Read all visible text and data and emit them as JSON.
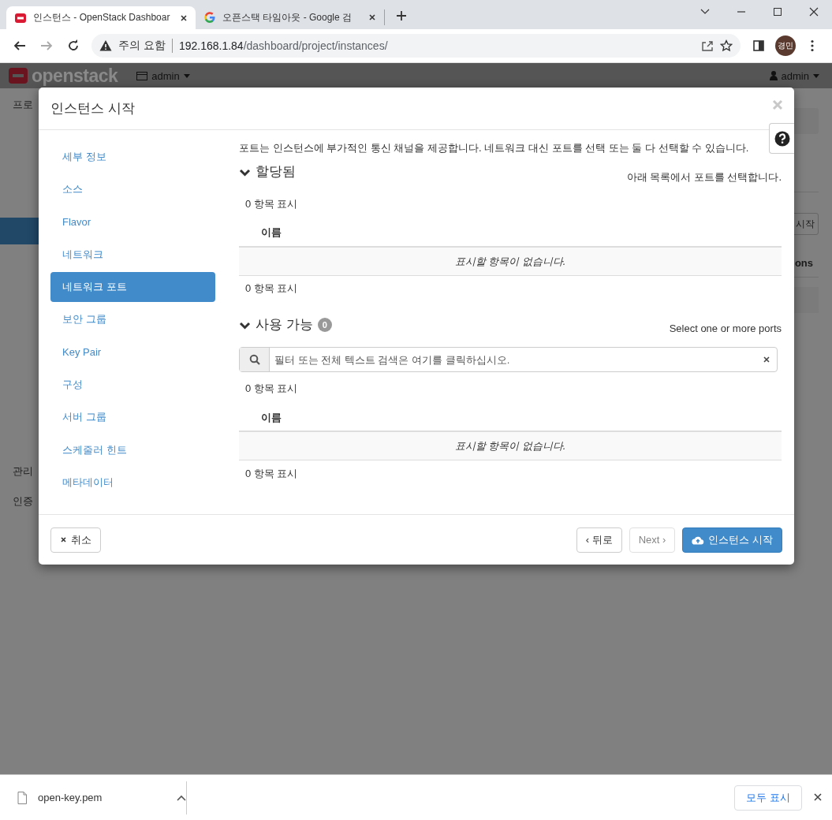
{
  "browser": {
    "tabs": [
      {
        "title": "인스턴스 - OpenStack Dashboar",
        "kind": "openstack",
        "selected": true
      },
      {
        "title": "오픈스택 타임아웃 - Google 검",
        "kind": "google",
        "selected": false
      }
    ],
    "security_label": "주의 요함",
    "url": {
      "host": "192.168.1.84",
      "path": "/dashboard/project/instances/"
    },
    "profile": "경민"
  },
  "navbar": {
    "logo": "openstack",
    "project": "admin",
    "user": "admin"
  },
  "background": {
    "sidebar": [
      {
        "label": "프로",
        "kind": "text"
      },
      {
        "kind": "highlight"
      },
      {
        "label": "관리",
        "kind": "text"
      },
      {
        "label": "인증",
        "kind": "text"
      }
    ],
    "button": "시작",
    "column_header": "ons"
  },
  "modal": {
    "title": "인스턴스 시작",
    "steps": [
      {
        "label": "세부 정보",
        "selected": false
      },
      {
        "label": "소스",
        "selected": false
      },
      {
        "label": "Flavor",
        "selected": false
      },
      {
        "label": "네트워크",
        "selected": false
      },
      {
        "label": "네트워크 포트",
        "selected": true
      },
      {
        "label": "보안 그룹",
        "selected": false
      },
      {
        "label": "Key Pair",
        "selected": false
      },
      {
        "label": "구성",
        "selected": false
      },
      {
        "label": "서버 그룹",
        "selected": false
      },
      {
        "label": "스케줄러 힌트",
        "selected": false
      },
      {
        "label": "메타데이터",
        "selected": false
      }
    ],
    "description": "포트는 인스턴스에 부가적인 통신 채널을 제공합니다. 네트워크 대신 포트를 선택 또는 둘 다 선택할 수 있습니다.",
    "sections": [
      {
        "title": "할당됨",
        "help": "아래 목록에서 포트를 선택합니다.",
        "count_top": "0 항목 표시",
        "column": "이름",
        "empty": "표시할 항목이 없습니다.",
        "count_bottom": "0 항목 표시",
        "expanded": true
      },
      {
        "title": "사용 가능",
        "badge": "0",
        "help": "Select one or more ports",
        "search": {
          "placeholder": "필터 또는 전체 텍스트 검색은 여기를 클릭하십시오."
        },
        "count_top": "0 항목 표시",
        "column": "이름",
        "empty": "표시할 항목이 없습니다.",
        "count_bottom": "0 항목 표시",
        "expanded": true
      }
    ],
    "buttons": [
      {
        "label": "취소",
        "kind": "cancel",
        "disabled": false
      },
      {
        "label": "‹ 뒤로",
        "kind": "back",
        "disabled": false
      },
      {
        "label": "Next ›",
        "kind": "next",
        "disabled": true
      },
      {
        "label": "인스턴스 시작",
        "kind": "primary",
        "disabled": false
      }
    ]
  },
  "downloads": {
    "file": "open-key.pem",
    "show_all": "모두 표시"
  }
}
